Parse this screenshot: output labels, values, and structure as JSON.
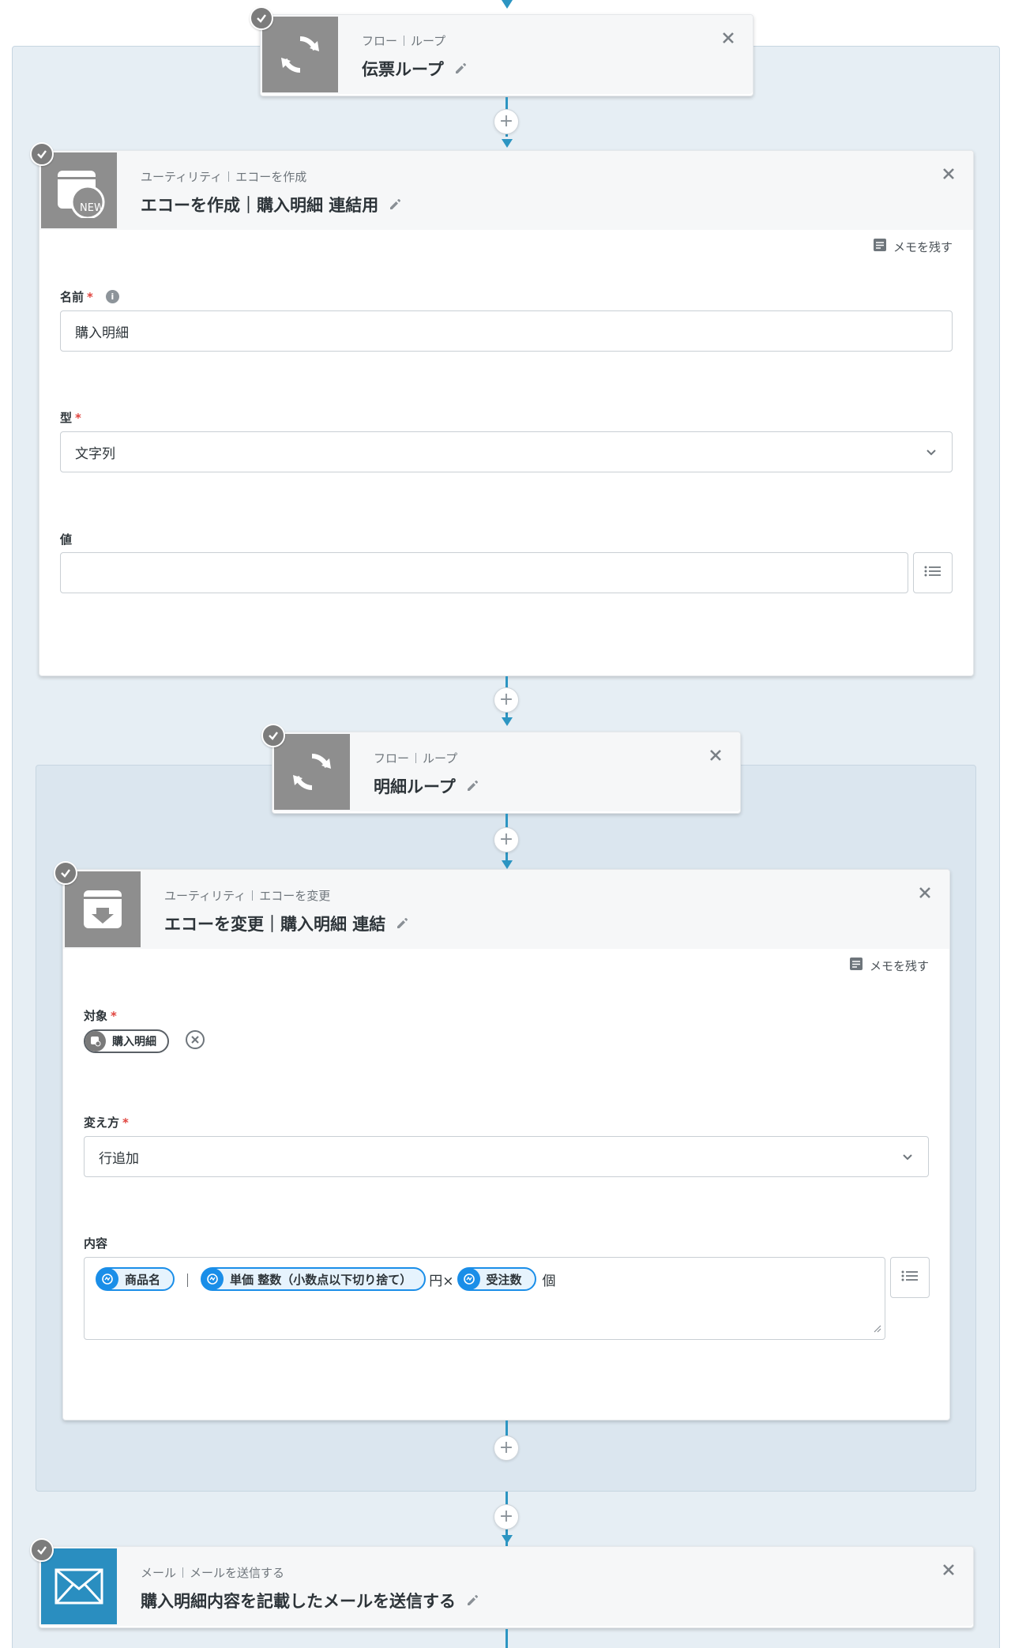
{
  "loop1": {
    "category": "フロー",
    "action": "ループ",
    "title": "伝票ループ"
  },
  "echo_create": {
    "category": "ユーティリティ",
    "action": "エコーを作成",
    "title": "エコーを作成｜購入明細 連結用",
    "icon_badge": "NEW",
    "memo_label": "メモを残す",
    "name_label": "名前",
    "name_value": "購入明細",
    "type_label": "型",
    "type_value": "文字列",
    "value_label": "値",
    "value_value": ""
  },
  "loop2": {
    "category": "フロー",
    "action": "ループ",
    "title": "明細ループ"
  },
  "echo_change": {
    "category": "ユーティリティ",
    "action": "エコーを変更",
    "title": "エコーを変更｜購入明細 連結",
    "memo_label": "メモを残す",
    "target_label": "対象",
    "target_chip": "購入明細",
    "method_label": "変え方",
    "method_value": "行追加",
    "content_label": "内容",
    "content": {
      "chip1": "商品名",
      "sep1": "｜",
      "chip2": "単価 整数（小数点以下切り捨て）",
      "text1": "円×",
      "chip3": "受注数",
      "text2": "個"
    }
  },
  "mail": {
    "category": "メール",
    "action": "メールを送信する",
    "title": "購入明細内容を記載したメールを送信する"
  },
  "colors": {
    "connector": "#2c95c2",
    "loop_bg": "#e6eef4",
    "inner_loop_bg": "#dbe6ef",
    "variable_chip": "#1a8ee8",
    "required": "#e0443e",
    "mail_icon": "#2a8ec0"
  }
}
